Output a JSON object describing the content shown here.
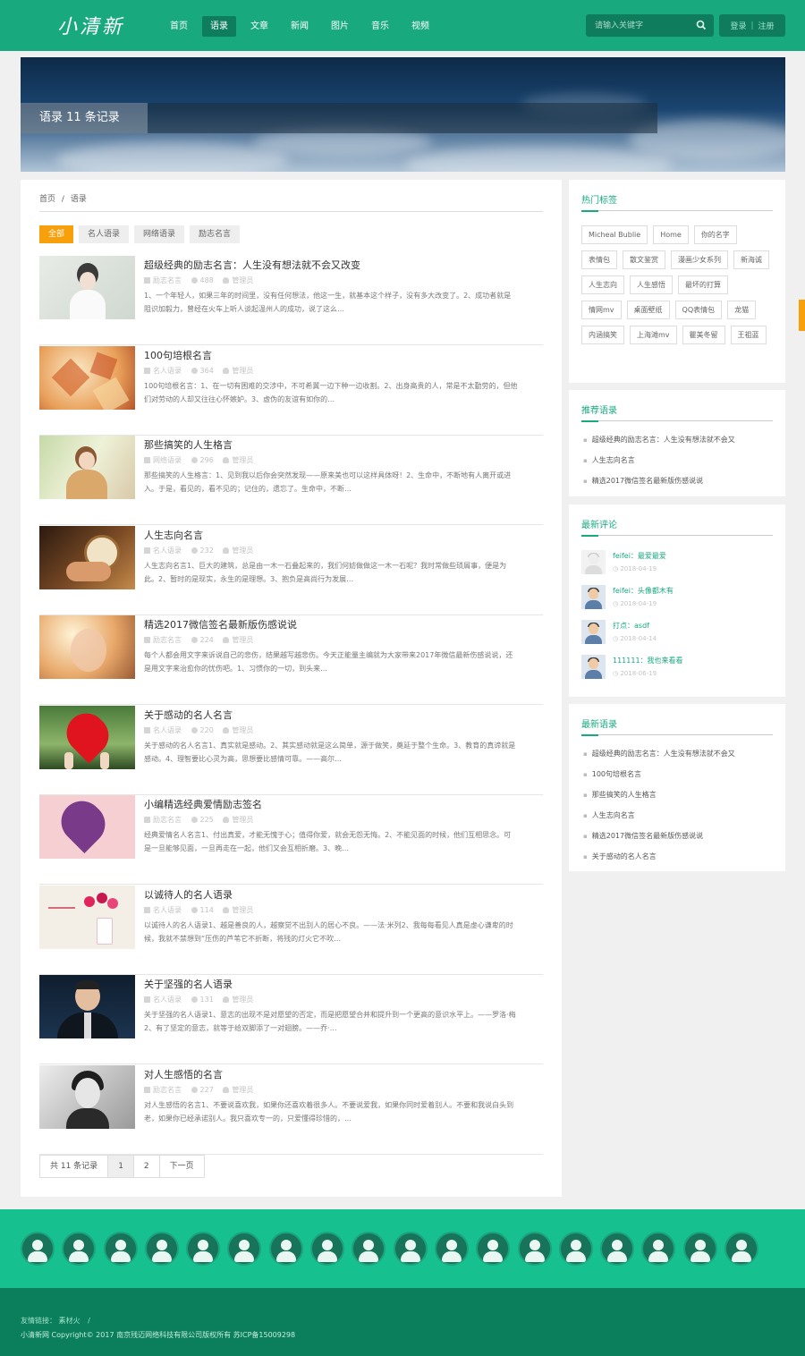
{
  "header": {
    "logo": "小清新",
    "nav": [
      {
        "label": "首页",
        "active": false
      },
      {
        "label": "语录",
        "active": true
      },
      {
        "label": "文章",
        "active": false
      },
      {
        "label": "新闻",
        "active": false
      },
      {
        "label": "图片",
        "active": false
      },
      {
        "label": "音乐",
        "active": false
      },
      {
        "label": "视频",
        "active": false
      }
    ],
    "search_placeholder": "请输入关键字",
    "login": "登录",
    "auth_sep": "|",
    "register": "注册"
  },
  "banner": {
    "title": "语录  11 条记录"
  },
  "breadcrumb": {
    "home": "首页",
    "sep": "/",
    "current": "语录"
  },
  "filters": [
    {
      "label": "全部",
      "active": true
    },
    {
      "label": "名人语录",
      "active": false
    },
    {
      "label": "网络语录",
      "active": false
    },
    {
      "label": "励志名言",
      "active": false
    }
  ],
  "articles": [
    {
      "title": "超级经典的励志名言：人生没有想法就不会又改变",
      "category": "励志名言",
      "views": "488",
      "author": "管理员",
      "excerpt": "1、一个年轻人，如果三年的时间里，没有任何想法，他这一生，就基本这个样子，没有多大改变了。2、成功者就是阻识加毅力，曾经在火车上听人谈起温州人的成功，说了这么…"
    },
    {
      "title": "100句培根名言",
      "category": "名人语录",
      "views": "364",
      "author": "管理员",
      "excerpt": "100句培根名言：1、在一切有困难的交涉中，不可希冀一边下种一边收割。2、出身高贵的人，常是不太勤劳的，但他们对劳动的人却又往往心怀嫉妒。3、虚伪的友谊有如你的…"
    },
    {
      "title": "那些搞笑的人生格言",
      "category": "网络语录",
      "views": "296",
      "author": "管理员",
      "excerpt": "那些搞笑的人生格言：1、见到我以后你会突然发现——原来美也可以这样具体呀！2、生命中，不断地有人离开或进入。于是，看见的，看不见的；记住的，遗忘了。生命中，不断…"
    },
    {
      "title": "人生志向名言",
      "category": "名人语录",
      "views": "232",
      "author": "管理员",
      "excerpt": "人生志向名言1、巨大的建筑，总是由一木一石叠起来的，我们何妨做做这一木一石呢？我时常做些琐屑事，便是为此。2、暂时的是现实，永生的是理想。3、抱负是高尚行为发展…"
    },
    {
      "title": "精选2017微信签名最新版伤感说说",
      "category": "励志名言",
      "views": "224",
      "author": "管理员",
      "excerpt": "每个人都会用文字来诉说自己的悲伤，结果越写越悲伤。今天正能量主编就为大家带来2017年微信最新伤感说说，还是用文字来治愈你的忧伤吧。1、习惯你的一切，到头来…"
    },
    {
      "title": "关于感动的名人名言",
      "category": "名人语录",
      "views": "220",
      "author": "管理员",
      "excerpt": "关于感动的名人名言1、真实就是感动。2、其实感动就是这么简单，源于做笑，奠延于整个生命。3、教育的真谛就是感动。4、理智要比心灵为高，思想要比感情可靠。——高尔…"
    },
    {
      "title": "小编精选经典爱情励志签名",
      "category": "励志名言",
      "views": "225",
      "author": "管理员",
      "excerpt": "经典爱情名人名言1、付出真爱，才能无愧于心；值得你爱，就会无怨无悔。2、不能见面的时候，他们互相思念。可是一旦能够见面，一旦再走在一起，他们又会互相折磨。3、晚…"
    },
    {
      "title": "以诚待人的名人语录",
      "category": "名人语录",
      "views": "114",
      "author": "管理员",
      "excerpt": "以诚待人的名人语录1、越是善良的人，越察觉不出别人的居心不良。——法·米列2、我每每看见人真是虚心谦卑的时候，我就不禁想到“压伤的芦苇它不折断，将残的灯火它不吹…"
    },
    {
      "title": "关于坚强的名人语录",
      "category": "名人语录",
      "views": "131",
      "author": "管理员",
      "excerpt": "关于坚强的名人语录1、意志的出现不是对愿望的否定，而是把愿望合并和提升到一个更高的意识水平上。——罗洛·梅2、有了坚定的意志，就等于给双脚添了一对翅膀。——乔·…"
    },
    {
      "title": "对人生感悟的名言",
      "category": "励志名言",
      "views": "227",
      "author": "管理员",
      "excerpt": "对人生感悟的名言1、不要说喜欢我，如果你还喜欢着很多人。不要说爱我，如果你同时爱着别人。不要和我说白头到老，如果你已经承诺别人。我只喜欢专一的，只爱懂得珍惜的，…"
    }
  ],
  "pager": {
    "info": "共 11 条记录",
    "pages": [
      "1",
      "2"
    ],
    "current": "1",
    "next": "下一页"
  },
  "sidebar": {
    "hot_tags_title": "热门标签",
    "hot_tags": [
      "Micheal Bublie",
      "Home",
      "你的名字",
      "表情包",
      "散文鉴赏",
      "漫画少女系列",
      "新海诚",
      "人生志向",
      "人生感悟",
      "最坏的打算",
      "情网mv",
      "桌面壁纸",
      "QQ表情包",
      "龙猫",
      "内涵搞笑",
      "上海滩mv",
      "瞿美冬留",
      "王祖蓝"
    ],
    "recommend_title": "推荐语录",
    "recommend": [
      "超级经典的励志名言：人生没有想法就不会又",
      "人生志向名言",
      "精选2017微信签名最新版伤感说说"
    ],
    "comments_title": "最新评论",
    "comments": [
      {
        "user": "feifei",
        "text": "最爱最爱",
        "time": "2018-04-19"
      },
      {
        "user": "feifei",
        "text": "头像都木有",
        "time": "2018-04-19"
      },
      {
        "user": "打点",
        "text": "asdf",
        "time": "2018-04-14"
      },
      {
        "user": "111111",
        "text": "我也来看看",
        "time": "2018-06-19"
      }
    ],
    "latest_title": "最新语录",
    "latest": [
      "超级经典的励志名言：人生没有想法就不会又",
      "100句培根名言",
      "那些搞笑的人生格言",
      "人生志向名言",
      "精选2017微信签名最新版伤感说说",
      "关于感动的名人名言"
    ]
  },
  "footer": {
    "links_label": "友情链接：",
    "links": [
      "素材火"
    ],
    "link_sep": "/",
    "copyright": "小清新网 Copyright© 2017 南京残迈网络科技有限公司版权所有 苏ICP备15009298"
  },
  "colors": {
    "brand": "#18a97f",
    "accent": "#f7a00c",
    "footer": "#0b7e5c",
    "members_bg": "#16c08f"
  }
}
